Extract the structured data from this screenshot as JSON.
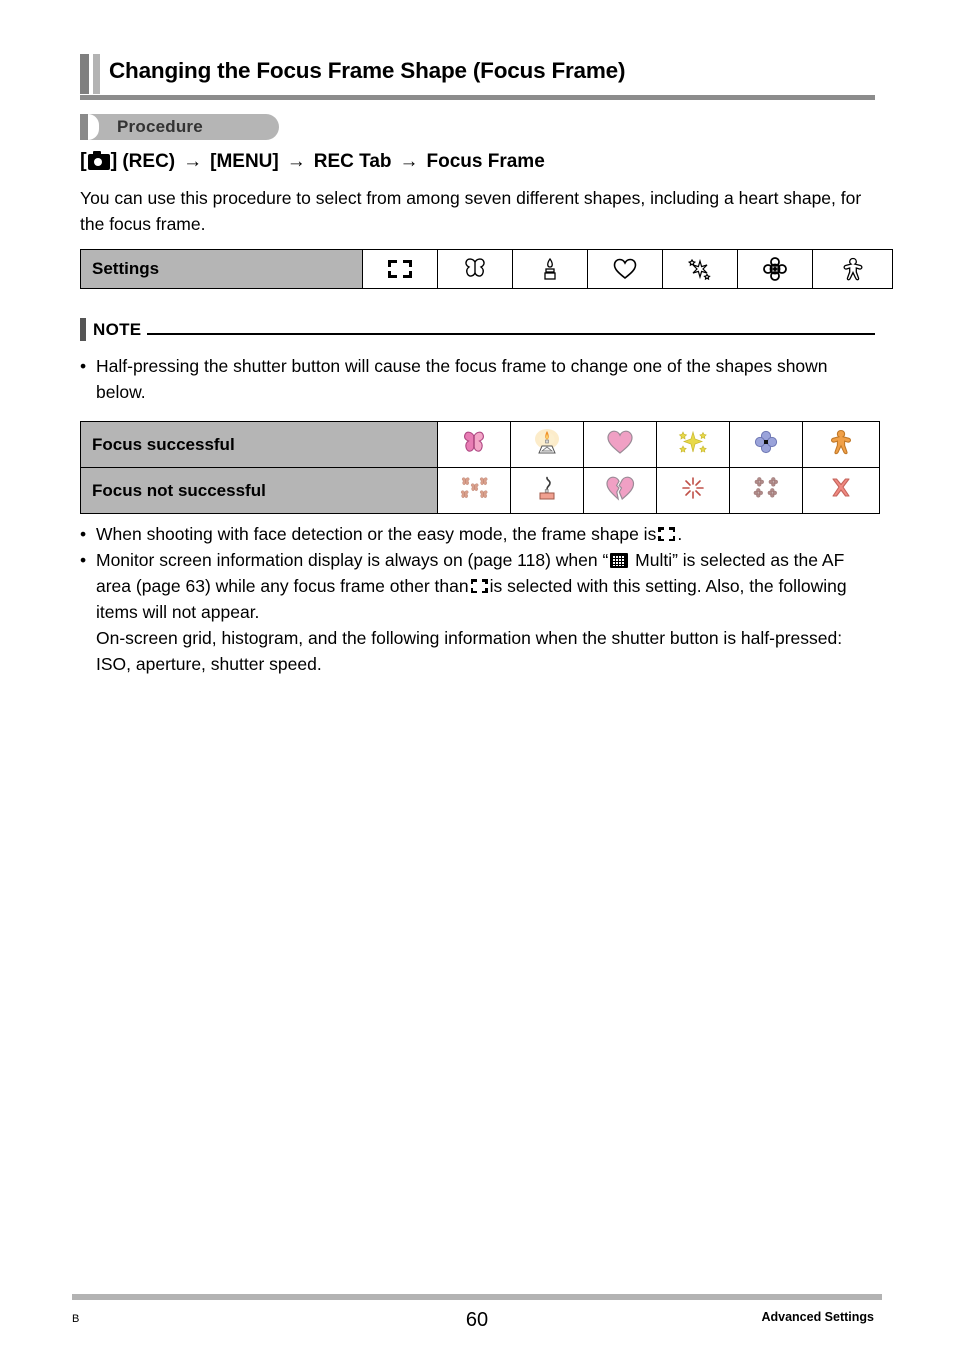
{
  "page": {
    "title": "Changing the Focus Frame Shape (Focus Frame)",
    "procedure_badge": "Procedure",
    "procedure_path": {
      "camera_label_open": "[",
      "camera_label_close": "]",
      "rec_label": "(REC)",
      "menu_label": "[MENU]",
      "rec_tab_label": "REC Tab",
      "focus_frame_label": "Focus Frame",
      "arrow_glyph": "→"
    },
    "intro_paragraph": "You can use this procedure to select from among seven different shapes, including a heart shape, for the focus frame.",
    "settings_table": {
      "label": "Settings",
      "icons": [
        "focus-frame-bracket-icon",
        "butterfly-outline-icon",
        "candle-outline-icon",
        "heart-outline-icon",
        "sparkle-outline-icon",
        "flower-outline-icon",
        "gingerbread-outline-icon"
      ]
    },
    "note": {
      "heading": "NOTE",
      "bullet_dot": "•",
      "bullets": [
        "Half-pressing the shutter button will cause the focus frame to change one of the shapes shown below."
      ]
    },
    "focus_table": {
      "rows": [
        {
          "label": "Focus successful",
          "icons": [
            "butterfly-pink-icon",
            "candle-lit-icon",
            "heart-pink-icon",
            "sparkle-yellow-icon",
            "flower-blue-icon",
            "gingerbread-orange-icon"
          ]
        },
        {
          "label": "Focus not successful",
          "icons": [
            "butterflies-scattered-icon",
            "candle-extinguished-icon",
            "heart-broken-icon",
            "sparkle-faded-icon",
            "flower-scattered-icon",
            "gingerbread-broken-icon"
          ]
        }
      ]
    },
    "lower_bullets": {
      "bullet_dot": "•",
      "bullet_1_before": "When shooting with face detection or the easy mode, the frame shape is",
      "bullet_1_after": ".",
      "bullet_2_part_1": "Monitor screen information display is always on (page 118) when “",
      "bullet_2_part_2": " Multi” is selected as the AF area (page 63) while any focus frame other than",
      "bullet_2_part_3": "is selected with this setting. Also, the following items will not appear.",
      "bullet_2_part_4": "On-screen grid, histogram, and the following information when the shutter button is half-pressed: ISO, aperture, shutter speed."
    },
    "footer": {
      "left": "B",
      "page_number": "60",
      "right": "Advanced Settings"
    },
    "colors": {
      "title_bar_dark": "#7f7f7f",
      "title_bar_light": "#b3b3b3",
      "table_label_bg": "#b5b5b5",
      "pink": "#e87cb4",
      "light_pink": "#f4a7c8",
      "yellow": "#e8d94a",
      "blue": "#9aa3da",
      "orange": "#f0a048",
      "red": "#c85050"
    }
  }
}
